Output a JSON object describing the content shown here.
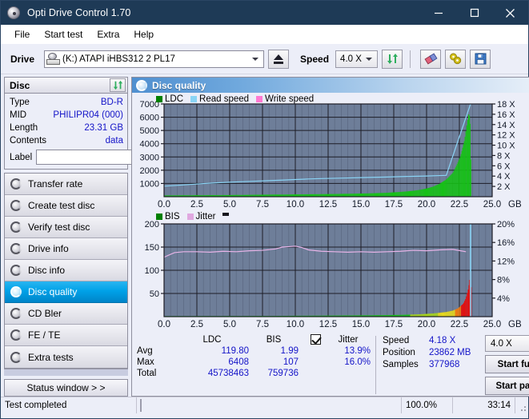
{
  "window": {
    "title": "Opti Drive Control 1.70",
    "icon": "disc-icon",
    "minimize": "–",
    "maximize": "□",
    "close": "✕"
  },
  "menu": {
    "items": [
      {
        "label": "File"
      },
      {
        "label": "Start test"
      },
      {
        "label": "Extra"
      },
      {
        "label": "Help"
      }
    ]
  },
  "toolbar": {
    "drive_label": "Drive",
    "drive_value": "(K:)  ATAPI iHBS312  2 PL17",
    "eject_title": "eject-button",
    "speed_label": "Speed",
    "speed_value": "4.0 X",
    "refresh_title": "refresh-button",
    "erase_title": "erase-button",
    "plug_title": "plugin-button",
    "save_title": "save-button"
  },
  "disc": {
    "header": "Disc",
    "refresh_icon": "refresh-icon",
    "rows": [
      {
        "key": "Type",
        "value": "BD-R"
      },
      {
        "key": "MID",
        "value": "PHILIPR04 (000)"
      },
      {
        "key": "Length",
        "value": "23.31 GB"
      },
      {
        "key": "Contents",
        "value": "data"
      }
    ],
    "label_key": "Label",
    "label_value": "",
    "label_placeholder": ""
  },
  "nav": {
    "items": [
      {
        "label": "Transfer rate",
        "active": false
      },
      {
        "label": "Create test disc",
        "active": false
      },
      {
        "label": "Verify test disc",
        "active": false
      },
      {
        "label": "Drive info",
        "active": false
      },
      {
        "label": "Disc info",
        "active": false
      },
      {
        "label": "Disc quality",
        "active": true
      },
      {
        "label": "CD Bler",
        "active": false
      },
      {
        "label": "FE / TE",
        "active": false
      },
      {
        "label": "Extra tests",
        "active": false
      }
    ],
    "status_button": "Status window > >"
  },
  "panel": {
    "title": "Disc quality",
    "icon": "disc-quality-icon"
  },
  "stats": {
    "col_headers": [
      "LDC",
      "BIS"
    ],
    "jitter_label": "Jitter",
    "jitter_checked": true,
    "rows": [
      {
        "key": "Avg",
        "ldc": "119.80",
        "bis": "1.99",
        "jitter": "13.9%"
      },
      {
        "key": "Max",
        "ldc": "6408",
        "bis": "107",
        "jitter": "16.0%"
      },
      {
        "key": "Total",
        "ldc": "45738463",
        "bis": "759736",
        "jitter": ""
      }
    ],
    "speed_key": "Speed",
    "speed_value": "4.18 X",
    "position_key": "Position",
    "position_value": "23862 MB",
    "samples_key": "Samples",
    "samples_value": "377968",
    "speed_select": "4.0 X",
    "start_full": "Start full",
    "start_part": "Start part"
  },
  "statusbar": {
    "message": "Test completed",
    "percent_text": "100.0%",
    "percent_value": 100,
    "elapsed": "33:14"
  },
  "chart_data": [
    {
      "type": "area",
      "name": "ldc-chart",
      "title": "",
      "xlabel": "GB",
      "ylabel": "",
      "xlim": [
        0,
        25
      ],
      "ylim": [
        0,
        7000
      ],
      "y2lim": [
        0,
        18
      ],
      "y2label": "X",
      "xticks": [
        "0.0",
        "2.5",
        "5.0",
        "7.5",
        "10.0",
        "12.5",
        "15.0",
        "17.5",
        "20.0",
        "22.5",
        "25.0"
      ],
      "yticks": [
        "1000",
        "2000",
        "3000",
        "4000",
        "5000",
        "6000",
        "7000"
      ],
      "y2ticks": [
        "2 X",
        "4 X",
        "6 X",
        "8 X",
        "10 X",
        "12 X",
        "14 X",
        "16 X",
        "18 X"
      ],
      "grid": true,
      "legend_position": "top-left",
      "legend": [
        {
          "label": "LDC",
          "color": "#00a000"
        },
        {
          "label": "Read speed",
          "color": "#8ad4f5"
        },
        {
          "label": "Write speed",
          "color": "#ff79d2"
        }
      ],
      "series": [
        {
          "name": "LDC",
          "color": "#16c116",
          "x": [
            0.0,
            0.5,
            1.0,
            1.5,
            2.0,
            2.5,
            3.0,
            3.5,
            4.0,
            4.5,
            5.0,
            5.5,
            6.0,
            6.5,
            7.0,
            7.5,
            8.0,
            8.5,
            9.0,
            9.5,
            10.0,
            10.5,
            11.0,
            11.5,
            12.0,
            12.5,
            13.0,
            13.5,
            14.0,
            14.5,
            15.0,
            15.5,
            16.0,
            16.5,
            17.0,
            17.5,
            18.0,
            18.5,
            19.0,
            19.5,
            20.0,
            20.5,
            21.0,
            21.5,
            22.0,
            22.3,
            22.6,
            22.9,
            23.1,
            23.25,
            23.35,
            23.4
          ],
          "values": [
            95,
            105,
            100,
            110,
            105,
            115,
            110,
            120,
            115,
            125,
            120,
            135,
            130,
            140,
            150,
            150,
            160,
            165,
            160,
            170,
            175,
            180,
            185,
            190,
            195,
            200,
            205,
            215,
            220,
            230,
            240,
            250,
            265,
            280,
            300,
            330,
            360,
            400,
            450,
            520,
            620,
            760,
            980,
            1300,
            1800,
            2400,
            3100,
            4300,
            5600,
            6408,
            5200,
            400
          ]
        },
        {
          "name": "Read speed",
          "color": "#8ad4f5",
          "x": [
            0.0,
            1.0,
            2.0,
            3.0,
            4.0,
            5.0,
            6.0,
            7.0,
            8.0,
            9.0,
            10.0,
            11.0,
            12.0,
            13.0,
            14.0,
            15.0,
            16.0,
            17.0,
            18.0,
            19.0,
            20.0,
            21.0,
            21.5,
            23.35
          ],
          "values": [
            2.05,
            2.2,
            2.38,
            2.55,
            2.7,
            2.82,
            2.92,
            3.02,
            3.12,
            3.22,
            3.34,
            3.44,
            3.52,
            3.58,
            3.64,
            3.7,
            3.76,
            3.82,
            3.9,
            3.96,
            4.02,
            4.1,
            4.14,
            18.0
          ]
        }
      ]
    },
    {
      "type": "area",
      "name": "bis-jitter-chart",
      "title": "",
      "xlabel": "GB",
      "ylabel": "",
      "xlim": [
        0,
        25
      ],
      "ylim": [
        0,
        200
      ],
      "y2lim": [
        0,
        20
      ],
      "y2label": "%",
      "xticks": [
        "0.0",
        "2.5",
        "5.0",
        "7.5",
        "10.0",
        "12.5",
        "15.0",
        "17.5",
        "20.0",
        "22.5",
        "25.0"
      ],
      "yticks": [
        "50",
        "100",
        "150",
        "200"
      ],
      "y2ticks": [
        "4%",
        "8%",
        "12%",
        "16%",
        "20%"
      ],
      "grid": true,
      "legend_position": "top-left",
      "legend": [
        {
          "label": "BIS",
          "color": "#00a000"
        },
        {
          "label": "Jitter",
          "color": "#e0a8e0"
        }
      ],
      "series": [
        {
          "name": "BIS",
          "color": "#16c116",
          "x": [
            0.0,
            1.0,
            2.0,
            3.0,
            4.0,
            5.0,
            6.0,
            7.0,
            8.0,
            9.0,
            10.0,
            11.0,
            12.0,
            13.0,
            14.0,
            15.0,
            16.0,
            17.0,
            18.0,
            19.0,
            19.5,
            20.0,
            20.5,
            21.0,
            21.5,
            22.0,
            22.4,
            22.8,
            23.0,
            23.2,
            23.3,
            23.38,
            23.4
          ],
          "values": [
            1.2,
            1.3,
            1.2,
            1.4,
            1.3,
            1.5,
            1.4,
            1.6,
            1.5,
            1.7,
            1.9,
            2.0,
            2.2,
            2.4,
            2.6,
            2.8,
            3.0,
            3.4,
            3.8,
            4.6,
            5.2,
            6.0,
            7.0,
            8.4,
            10.0,
            13.0,
            18.0,
            28.0,
            40.0,
            62.0,
            85.0,
            107.0,
            20.0
          ]
        },
        {
          "name": "Jitter",
          "color": "#e8b4e8",
          "x": [
            0.0,
            0.3,
            0.8,
            1.5,
            2.5,
            3.5,
            4.5,
            5.5,
            6.5,
            7.5,
            8.5,
            9.0,
            9.5,
            10.0,
            10.5,
            11.0,
            12.0,
            13.0,
            14.0,
            15.0,
            16.0,
            17.0,
            18.0,
            19.0,
            20.0,
            21.0,
            22.0,
            22.6,
            23.0
          ],
          "values": [
            12.8,
            13.2,
            13.8,
            14.0,
            14.0,
            13.9,
            14.1,
            14.0,
            14.2,
            14.3,
            14.6,
            15.0,
            15.1,
            15.2,
            14.9,
            14.4,
            14.1,
            14.0,
            13.9,
            14.0,
            13.9,
            14.0,
            14.1,
            14.3,
            14.2,
            14.4,
            14.5,
            14.2,
            14.0
          ]
        }
      ],
      "markers": [
        {
          "x": 23.35,
          "color": "#8ad4f5",
          "name": "position-marker"
        }
      ]
    }
  ]
}
